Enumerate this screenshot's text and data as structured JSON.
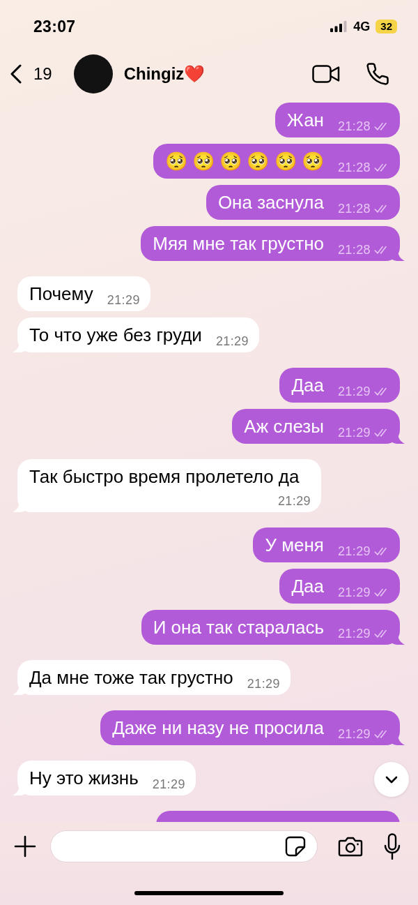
{
  "status_bar": {
    "time": "23:07",
    "network": "4G",
    "battery": "32"
  },
  "header": {
    "back_count": "19",
    "contact_name": "Chingiz❤️"
  },
  "messages": [
    {
      "kind": "outgoing",
      "text": "Жан",
      "time": "21:28",
      "delivered": true,
      "tail": false
    },
    {
      "kind": "outgoing",
      "text": "🥺 🥺 🥺 🥺 🥺 🥺",
      "time": "21:28",
      "delivered": true,
      "tail": false
    },
    {
      "kind": "outgoing",
      "text": "Она заснула",
      "time": "21:28",
      "delivered": true,
      "tail": false
    },
    {
      "kind": "outgoing",
      "text": "Мяя мне так грустно",
      "time": "21:28",
      "delivered": true,
      "tail": true
    },
    {
      "kind": "incoming",
      "text": "Почему",
      "time": "21:29",
      "tail": false
    },
    {
      "kind": "incoming",
      "text": "То что уже без груди",
      "time": "21:29",
      "tail": true
    },
    {
      "kind": "outgoing",
      "text": "Даа",
      "time": "21:29",
      "delivered": true,
      "tail": false
    },
    {
      "kind": "outgoing",
      "text": "Аж слезы",
      "time": "21:29",
      "delivered": true,
      "tail": true
    },
    {
      "kind": "incoming",
      "text": "Так быстро время пролетело да",
      "time": "21:29",
      "tail": true
    },
    {
      "kind": "outgoing",
      "text": "У меня",
      "time": "21:29",
      "delivered": true,
      "tail": false
    },
    {
      "kind": "outgoing",
      "text": "Даа",
      "time": "21:29",
      "delivered": true,
      "tail": false
    },
    {
      "kind": "outgoing",
      "text": "И она так старалась",
      "time": "21:29",
      "delivered": true,
      "tail": true
    },
    {
      "kind": "incoming",
      "text": "Да мне тоже так грустно",
      "time": "21:29",
      "tail": true
    },
    {
      "kind": "outgoing",
      "text": "Даже ни назу не просила",
      "time": "21:29",
      "delivered": true,
      "tail": true
    },
    {
      "kind": "incoming",
      "text": "Ну это жизнь",
      "time": "21:29",
      "tail": true
    },
    {
      "kind": "outgoing"
    }
  ]
}
